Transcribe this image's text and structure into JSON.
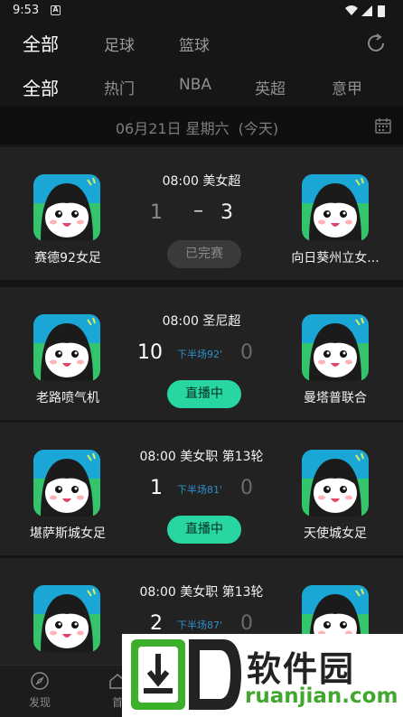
{
  "status_bar": {
    "time": "9:53",
    "notif_letter": "A"
  },
  "top_tabs": [
    {
      "label": "全部",
      "active": true
    },
    {
      "label": "足球",
      "active": false
    },
    {
      "label": "篮球",
      "active": false
    }
  ],
  "sub_tabs": [
    {
      "label": "全部",
      "active": true
    },
    {
      "label": "热门",
      "active": false
    },
    {
      "label": "NBA",
      "active": false
    },
    {
      "label": "英超",
      "active": false
    },
    {
      "label": "意甲",
      "active": false
    }
  ],
  "date_bar": {
    "date": "06月21日 星期六",
    "today": "(今天)"
  },
  "matches": [
    {
      "league": "08:00 美女超",
      "home": "赛德92女足",
      "away": "向日葵州立女...",
      "home_score": "1",
      "away_score": "3",
      "minute": "",
      "status": "已完赛"
    },
    {
      "league": "08:00 圣尼超",
      "home": "老路喷气机",
      "away": "曼塔普联合",
      "home_score": "10",
      "away_score": "0",
      "minute": "下半场92'",
      "status": "直播中"
    },
    {
      "league": "08:00 美女职 第13轮",
      "home": "堪萨斯城女足",
      "away": "天使城女足",
      "home_score": "1",
      "away_score": "0",
      "minute": "下半场81'",
      "status": "直播中"
    },
    {
      "league": "08:00 美女职 第13轮",
      "home": "",
      "away": "",
      "home_score": "2",
      "away_score": "0",
      "minute": "下半场87'",
      "status": ""
    }
  ],
  "bottom_nav": [
    {
      "label": "发现",
      "icon": "compass-icon"
    },
    {
      "label": "首",
      "icon": "home-icon"
    }
  ],
  "watermark": {
    "text": "软件园",
    "url": "ruanjian.com"
  },
  "colors": {
    "live": "#28d6a1",
    "minute": "#2e8ec9",
    "background": "#161616",
    "card": "#222222"
  }
}
